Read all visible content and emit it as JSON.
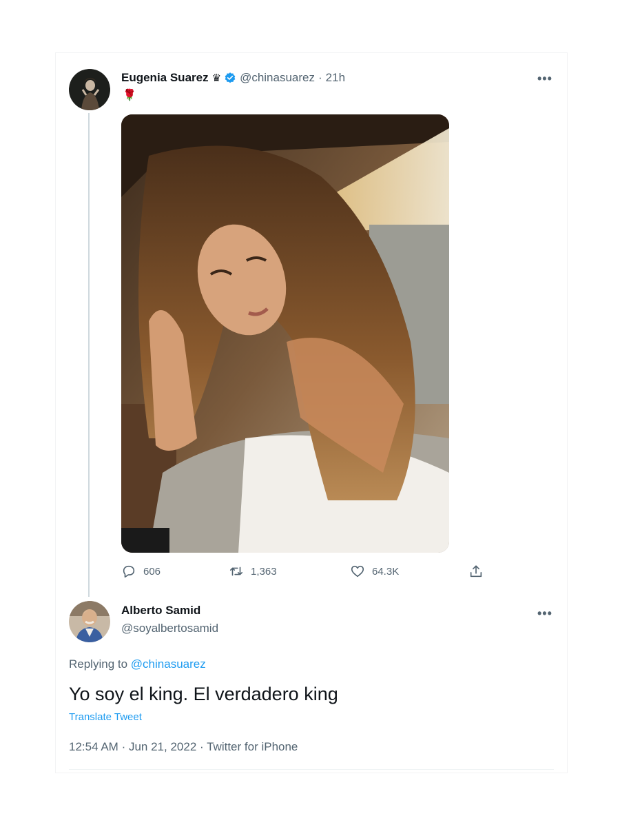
{
  "original_tweet": {
    "display_name": "Eugenia Suarez",
    "crown_glyph": "♛",
    "handle": "@chinasuarez",
    "separator": "·",
    "time": "21h",
    "text": "🌹",
    "more_label": "•••",
    "icons": {
      "crown": "crown-icon",
      "verified": "verified-badge-icon",
      "more": "more-options-icon"
    },
    "stats": {
      "replies": "606",
      "retweets": "1,363",
      "likes": "64.3K"
    }
  },
  "reply_tweet": {
    "display_name": "Alberto Samid",
    "handle": "@soyalbertosamid",
    "more_label": "•••",
    "replying_to_label": "Replying to",
    "replying_to_handle": "@chinasuarez",
    "text": "Yo soy el king. El verdadero king",
    "translate_label": "Translate Tweet",
    "time": "12:54 AM",
    "separator_1": "·",
    "date": "Jun 21, 2022",
    "separator_2": "·",
    "source": "Twitter for iPhone"
  },
  "colors": {
    "accent": "#1d9bf0",
    "text_primary": "#0f1419",
    "text_secondary": "#536471",
    "thread_line": "#cfd9de"
  }
}
